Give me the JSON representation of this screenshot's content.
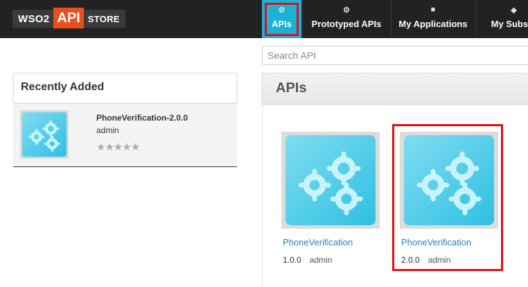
{
  "brand": {
    "left": "WSO2",
    "middle": "API",
    "right": "STORE"
  },
  "nav": {
    "tabs": [
      {
        "label": "APIs",
        "icon": "gears-icon"
      },
      {
        "label": "Prototyped APIs",
        "icon": "gear-icon"
      },
      {
        "label": "My Applications",
        "icon": "briefcase-icon"
      },
      {
        "label": "My Subscr",
        "icon": "tags-icon"
      }
    ]
  },
  "search": {
    "placeholder": "Search API"
  },
  "recent": {
    "title": "Recently Added",
    "item": {
      "name": "PhoneVerification-2.0.0",
      "owner": "admin",
      "rating": 0,
      "max_rating": 5
    }
  },
  "apis": {
    "title": "APIs",
    "cards": [
      {
        "name": "PhoneVerification",
        "version": "1.0.0",
        "owner": "admin"
      },
      {
        "name": "PhoneVerification",
        "version": "2.0.0",
        "owner": "admin"
      }
    ]
  },
  "colors": {
    "accent": "#1ab3d4",
    "brand_orange": "#e8501f",
    "highlight": "#e20d15",
    "link": "#2a7fb8"
  }
}
